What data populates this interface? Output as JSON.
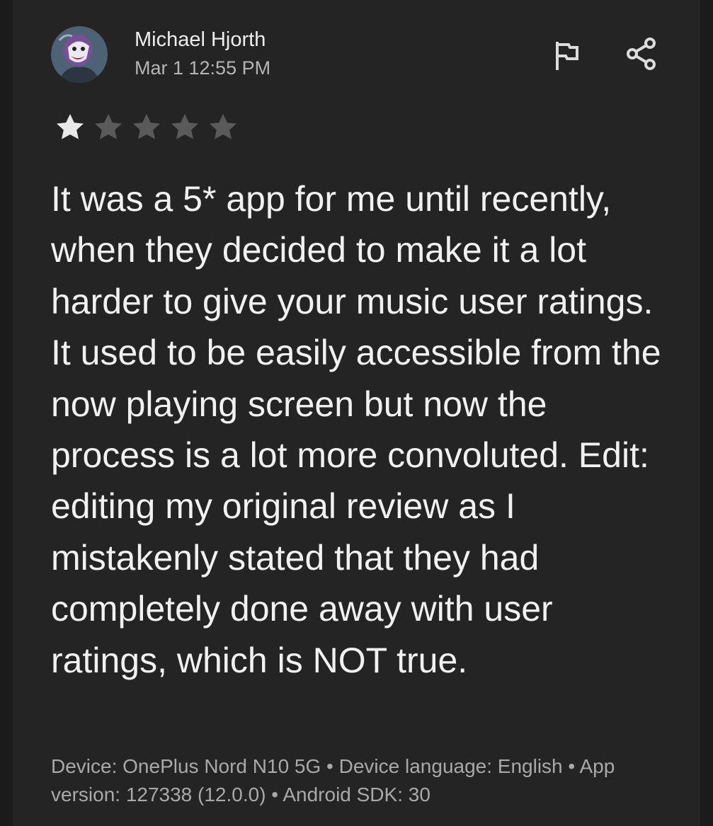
{
  "review": {
    "author": "Michael Hjorth",
    "date": "Mar 1 12:55 PM",
    "rating": 1,
    "rating_max": 5,
    "text": "It was a 5* app for me until recently, when they decided to make it a lot harder to give your music user ratings. It used to be easily accessible from the now playing screen but now the process is a lot more convoluted. Edit: editing my original review as I mistakenly stated that they had completely done away with user ratings, which is NOT true.",
    "device_info": "Device: OnePlus Nord N10 5G • Device language: English • App version: 127338 (12.0.0) • Android SDK: 30"
  },
  "actions": {
    "flag_icon": "flag-icon",
    "share_icon": "share-icon"
  },
  "colors": {
    "background": "#242424",
    "star_filled": "#e8e8e8",
    "star_empty": "#5a5a5a",
    "primary_text": "#f1f1f1",
    "secondary_text": "#a9a9a9"
  }
}
